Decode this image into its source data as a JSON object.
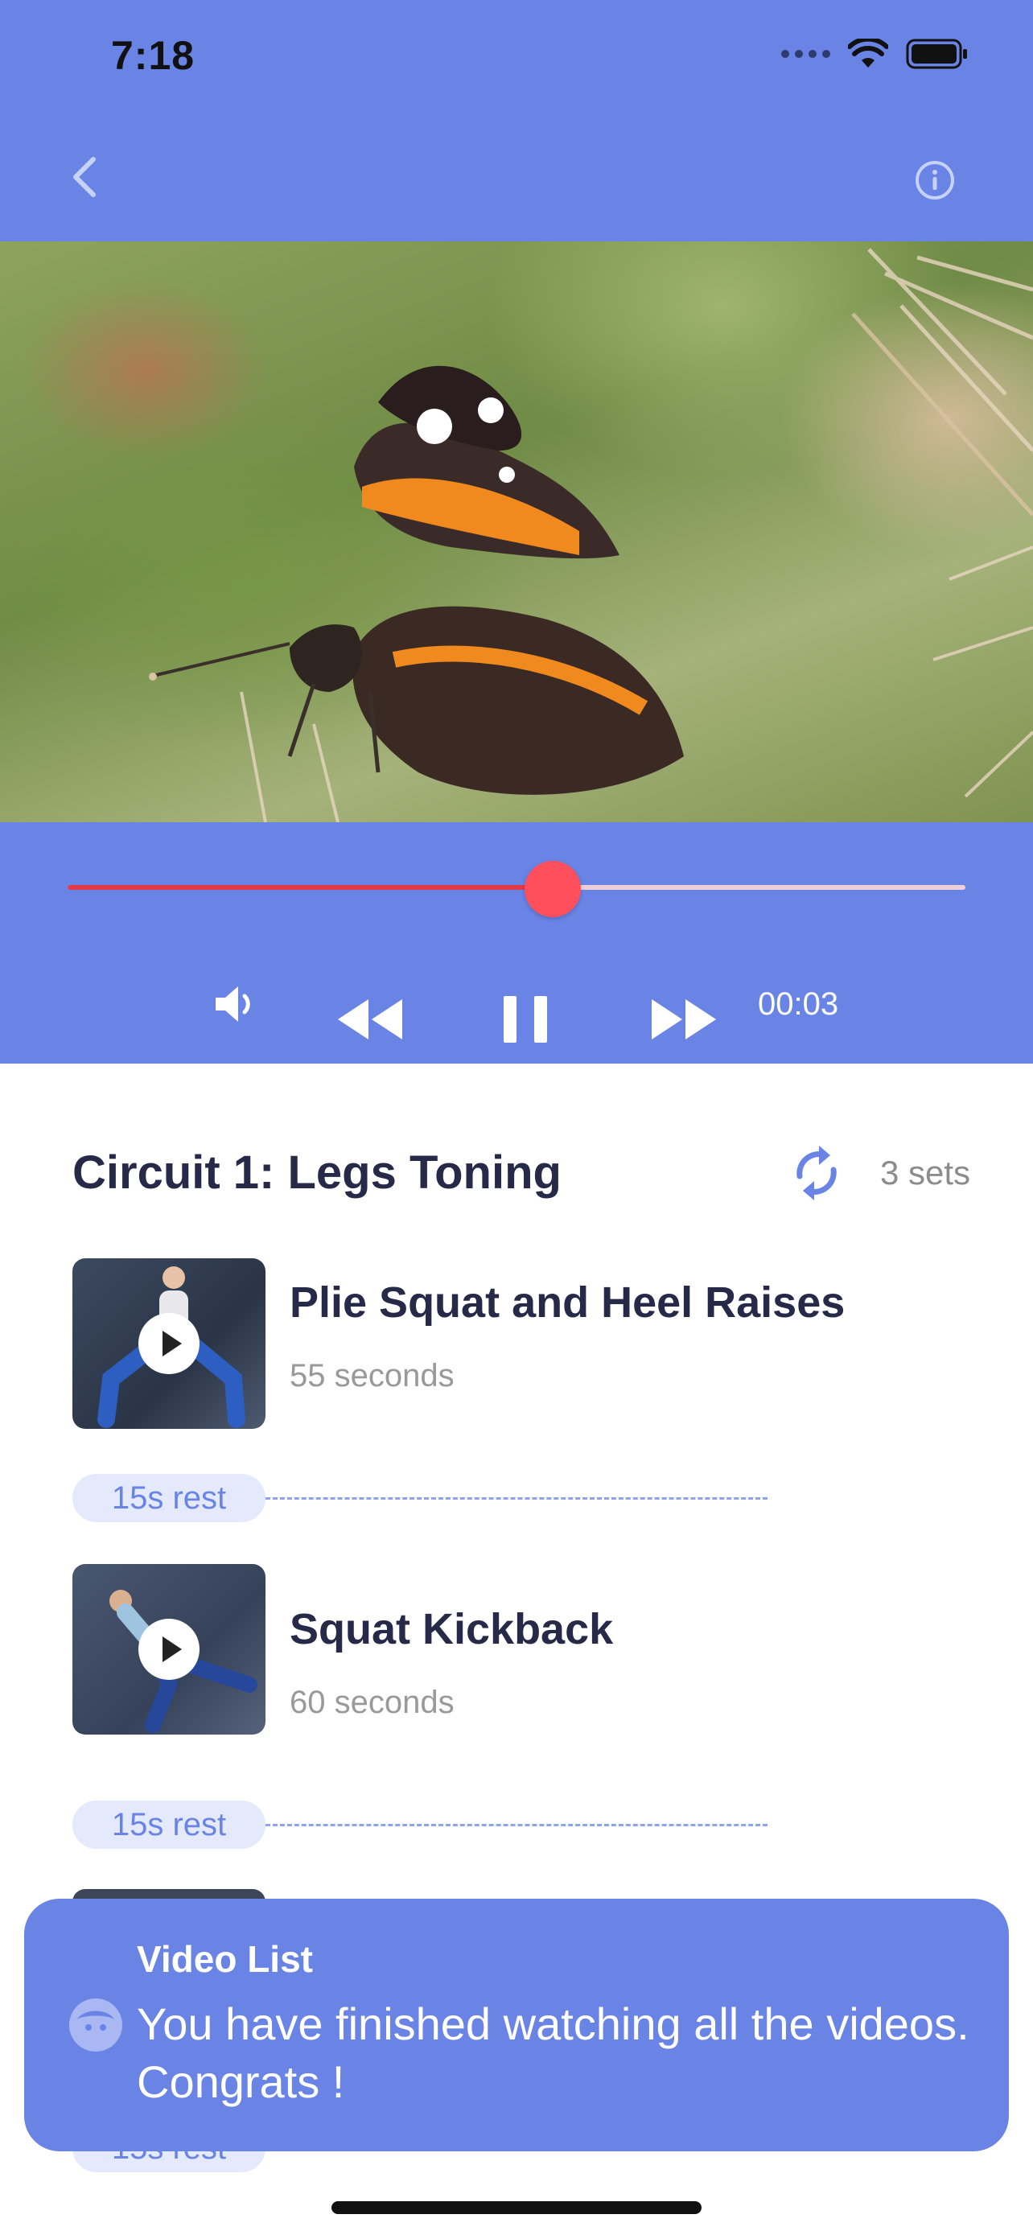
{
  "status_bar": {
    "time": "7:18"
  },
  "header": {
    "back_icon": "chevron-left-icon",
    "info_icon": "info-icon"
  },
  "video": {
    "subject": "butterfly-video-frame"
  },
  "player": {
    "progress": 0.54,
    "elapsed": "00:03",
    "volume_icon": "speaker-icon",
    "rewind_icon": "rewind-icon",
    "pause_icon": "pause-icon",
    "forward_icon": "fast-forward-icon",
    "colors": {
      "bar": "#6a84e6",
      "progress": "#e23b48",
      "thumb": "#ff4f5d"
    }
  },
  "circuit": {
    "title": "Circuit 1: Legs Toning",
    "sets_label": "3 sets",
    "exercises": [
      {
        "name": "Plie Squat and Heel Raises",
        "duration": "55 seconds"
      },
      {
        "name": "Squat Kickback",
        "duration": "60 seconds"
      }
    ],
    "rests": [
      "15s rest",
      "15s rest",
      "15s rest"
    ]
  },
  "toast": {
    "title": "Video List",
    "message": "You have finished watching all the videos. Congrats !"
  }
}
